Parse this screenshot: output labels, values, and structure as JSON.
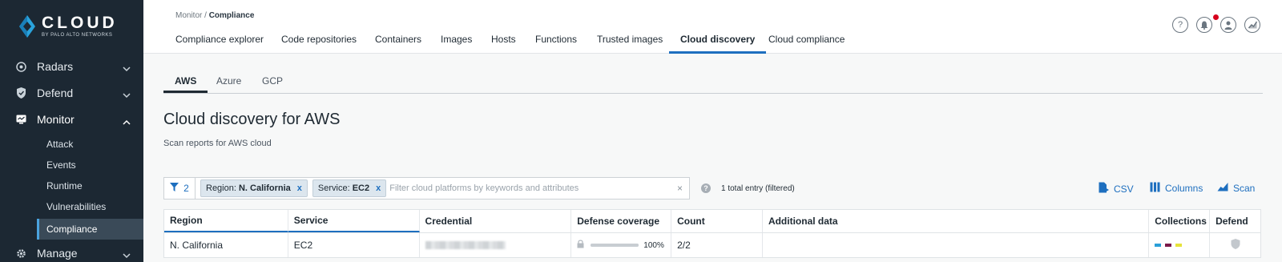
{
  "brand": {
    "name": "CLOUD",
    "tagline": "BY PALO ALTO NETWORKS"
  },
  "sidebar": {
    "items": [
      {
        "label": "Radars",
        "icon": "radar-icon"
      },
      {
        "label": "Defend",
        "icon": "shield-icon"
      },
      {
        "label": "Monitor",
        "icon": "monitor-icon",
        "expanded": true
      },
      {
        "label": "Manage",
        "icon": "gear-icon"
      }
    ],
    "monitor_children": [
      "Attack",
      "Events",
      "Runtime",
      "Vulnerabilities",
      "Compliance"
    ],
    "active_child": "Compliance"
  },
  "header": {
    "breadcrumb_parent": "Monitor",
    "breadcrumb_separator": "/",
    "breadcrumb_current": "Compliance",
    "tabs": [
      "Compliance explorer",
      "Code repositories",
      "Containers",
      "Images",
      "Hosts",
      "Functions",
      "Trusted images",
      "Cloud discovery",
      "Cloud compliance"
    ],
    "active_tab": "Cloud discovery",
    "icons": [
      "help-icon",
      "bell-icon",
      "user-icon",
      "chart-icon"
    ]
  },
  "provider_tabs": [
    "AWS",
    "Azure",
    "GCP"
  ],
  "active_provider": "AWS",
  "page": {
    "title": "Cloud discovery for AWS",
    "subtitle": "Scan reports for AWS cloud"
  },
  "filter": {
    "count": "2",
    "chips": [
      {
        "key": "Region:",
        "value": "N. California"
      },
      {
        "key": "Service:",
        "value": "EC2"
      }
    ],
    "placeholder": "Filter cloud platforms by keywords and attributes",
    "clear": "×",
    "entries": "1 total entry (filtered)"
  },
  "actions": {
    "csv": "CSV",
    "columns": "Columns",
    "scan": "Scan"
  },
  "table": {
    "columns": [
      "Region",
      "Service",
      "Credential",
      "Defense coverage",
      "Count",
      "Additional data",
      "Collections",
      "Defend"
    ],
    "rows": [
      {
        "region": "N. California",
        "service": "EC2",
        "credential": "",
        "coverage": "100%",
        "coverage_fraction": 1.0,
        "count": "2/2",
        "additional": "",
        "collection_colors": [
          "#2a9fd8",
          "#7b1a4a",
          "#e6e33a"
        ]
      }
    ]
  },
  "colors": {
    "accent": "#1e6fbf",
    "sidebar": "#1c2833",
    "active_nav": "#4aa3df"
  }
}
